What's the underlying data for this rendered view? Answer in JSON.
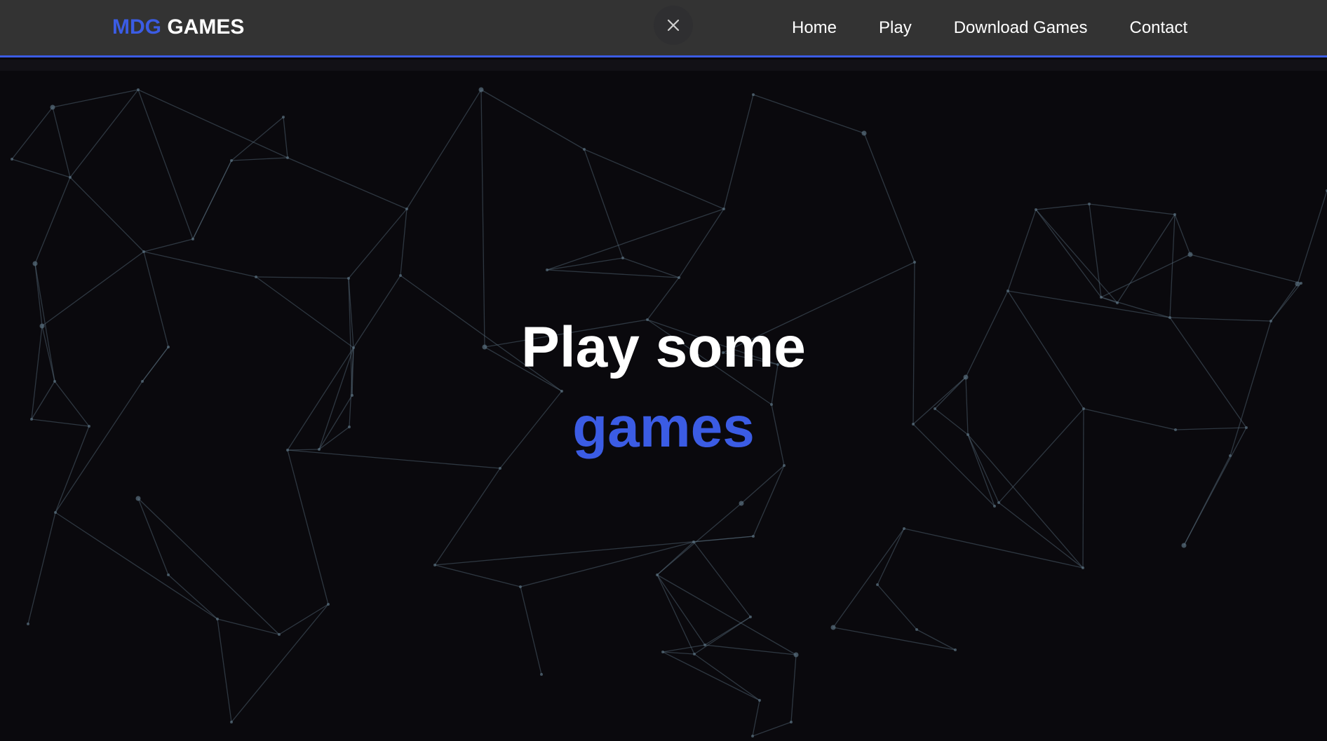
{
  "brand": {
    "accent_text": "MDG",
    "rest_text": "GAMES",
    "accent_color": "#3b5ce4"
  },
  "header": {
    "close_icon": "close-icon"
  },
  "nav": {
    "items": [
      {
        "label": "Home"
      },
      {
        "label": "Play"
      },
      {
        "label": "Download Games"
      },
      {
        "label": "Contact"
      }
    ]
  },
  "hero": {
    "line1": "Play some",
    "line2": "games"
  },
  "theme": {
    "background": "#0a090d",
    "navbar": "#333333",
    "network_line_color": "#5a7080"
  }
}
